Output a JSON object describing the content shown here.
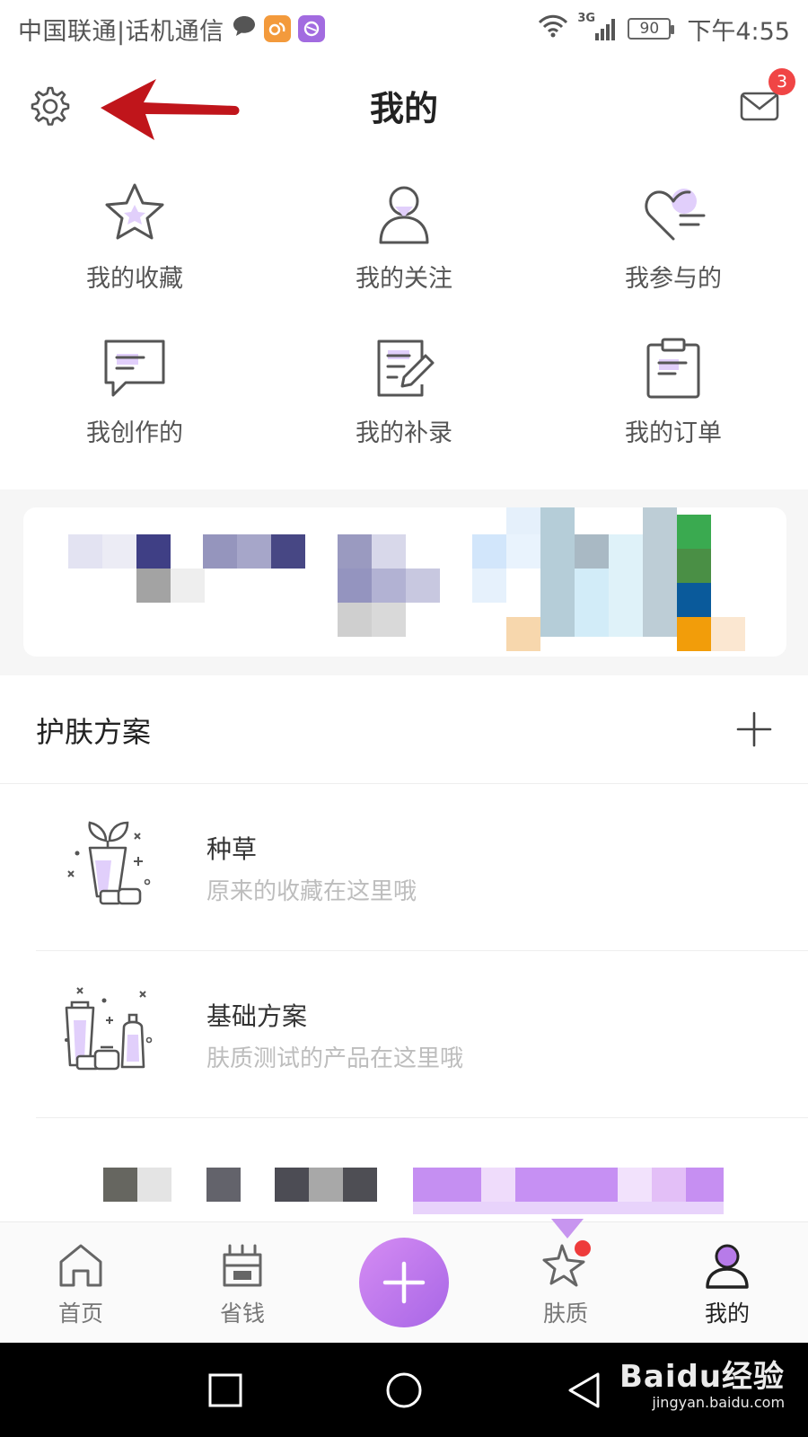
{
  "status_bar": {
    "carrier": "中国联通|话机通信",
    "network": "3G",
    "battery": "90",
    "time": "下午4:55"
  },
  "header": {
    "title": "我的",
    "settings_icon": "gear-icon",
    "mail_icon": "envelope-icon",
    "mail_badge": "3"
  },
  "annotation": {
    "arrow_color": "#c0151b"
  },
  "grid": [
    {
      "label": "我的收藏",
      "icon": "star-icon"
    },
    {
      "label": "我的关注",
      "icon": "person-icon"
    },
    {
      "label": "我参与的",
      "icon": "heart-icon"
    },
    {
      "label": "我创作的",
      "icon": "chat-bubble-icon"
    },
    {
      "label": "我的补录",
      "icon": "edit-note-icon"
    },
    {
      "label": "我的订单",
      "icon": "clipboard-icon"
    }
  ],
  "skin_plan": {
    "title": "护肤方案",
    "items": [
      {
        "name": "种草",
        "desc": "原来的收藏在这里哦",
        "icon": "plant-bottle-icon"
      },
      {
        "name": "基础方案",
        "desc": "肤质测试的产品在这里哦",
        "icon": "skincare-bottles-icon"
      }
    ]
  },
  "bottom_nav": [
    {
      "label": "首页",
      "icon": "home-icon"
    },
    {
      "label": "省钱",
      "icon": "coupon-icon"
    },
    {
      "label": "肤质",
      "icon": "sparkle-icon"
    },
    {
      "label": "我的",
      "icon": "user-icon"
    }
  ],
  "watermark": {
    "main": "Baidu经验",
    "sub": "jingyan.baidu.com"
  },
  "colors": {
    "accent": "#b77be9",
    "accent_light": "#e4d0fb",
    "badge": "#f04545",
    "annotation_arrow": "#c0151b"
  }
}
